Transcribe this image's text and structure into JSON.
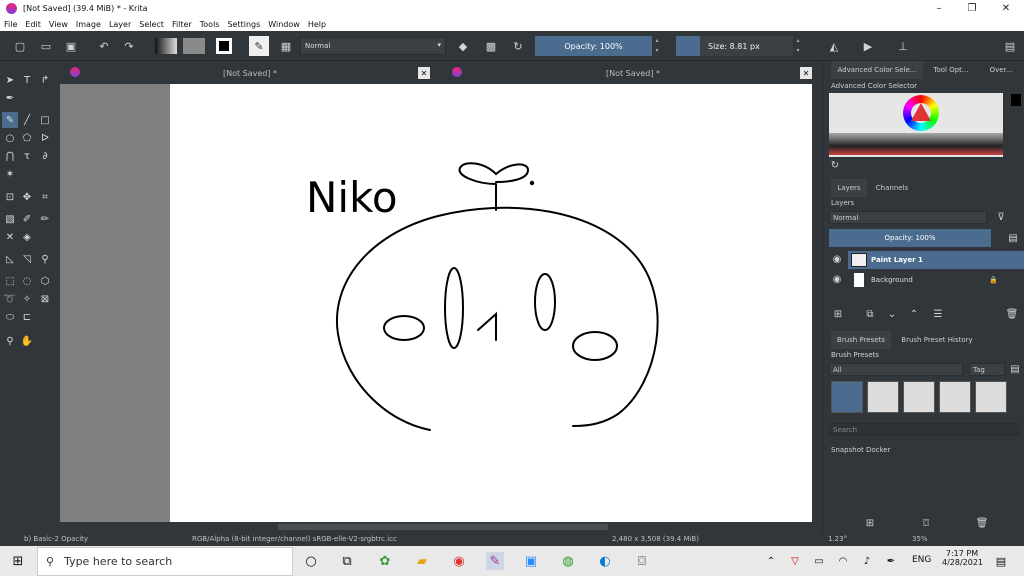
{
  "window": {
    "title": "[Not Saved]  (39.4 MiB)  * - Krita",
    "minimize": "–",
    "maximize": "❐",
    "close": "✕"
  },
  "menu": [
    "File",
    "Edit",
    "View",
    "Image",
    "Layer",
    "Select",
    "Filter",
    "Tools",
    "Settings",
    "Window",
    "Help"
  ],
  "toolbar": {
    "blending_mode": "Normal",
    "opacity": "Opacity: 100%",
    "size": "Size: 8.81 px"
  },
  "tabs": [
    {
      "label": "[Not Saved]  *",
      "close": "✕"
    },
    {
      "label": "[Not Saved]  *",
      "close": "✕"
    }
  ],
  "drawing": {
    "handwriting": "Niko"
  },
  "dockers": {
    "top_tabs": [
      "Advanced Color Sele...",
      "Tool Opt...",
      "Over..."
    ],
    "color_selector_title": "Advanced Color Selector",
    "layer_tabs": [
      "Layers",
      "Channels"
    ],
    "layers_title": "Layers",
    "layer_blend": "Normal",
    "layer_opacity": "Opacity:  100%",
    "layers": [
      {
        "name": "Paint Layer 1",
        "selected": true
      },
      {
        "name": "Background",
        "selected": false
      }
    ],
    "preset_tabs": [
      "Brush Presets",
      "Brush Preset History"
    ],
    "presets_title": "Brush Presets",
    "preset_filter": "All",
    "tag_label": "Tag",
    "search_placeholder": "Search",
    "snapshot_title": "Snapshot Docker"
  },
  "status": {
    "brush": "b) Basic-2 Opacity",
    "color_space": "RGB/Alpha (8-bit integer/channel)  sRGB-elle-V2-srgbtrc.icc",
    "image_size": "2,480 x 3,508 (39.4 MiB)",
    "rotation": "1.23°",
    "zoom": "35%"
  },
  "taskbar": {
    "search_placeholder": "Type here to search",
    "language": "ENG",
    "time": "7:17 PM",
    "date": "4/28/2021"
  }
}
